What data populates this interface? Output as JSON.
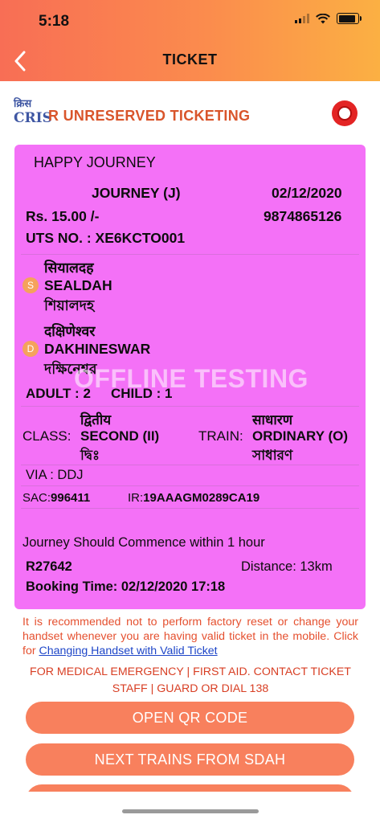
{
  "status_bar": {
    "time": "5:18"
  },
  "header": {
    "title": "TICKET"
  },
  "brand": {
    "logo_top": "क्रिस",
    "logo_bottom": "CRIS",
    "title": "R UNRESERVED TICKETING"
  },
  "ticket": {
    "greeting": "HAPPY JOURNEY",
    "journey_type": "JOURNEY (J)",
    "date": "02/12/2020",
    "fare": "Rs.  15.00 /-",
    "phone": "9874865126",
    "uts_no": "UTS NO. : XE6KCTO001",
    "source": {
      "hindi": "सियालदह",
      "english": "SEALDAH",
      "bengali": "শিয়ালদহ",
      "badge": "S"
    },
    "destination": {
      "hindi": "दक्षिणेश्वर",
      "english": "DAKHINESWAR",
      "bengali": "দক্ষিনেশ্বর",
      "badge": "D"
    },
    "passengers": {
      "adult": "ADULT : 2",
      "child": "CHILD : 1"
    },
    "class_label": "CLASS:",
    "class_hindi": "द्वितीय",
    "class_value": "SECOND (II)",
    "class_bengali": "দ্বিঃ",
    "train_label": "TRAIN:",
    "train_hindi": "साधारण",
    "train_value": "ORDINARY (O)",
    "train_bengali": "সাধারণ",
    "via": "VIA : DDJ",
    "sac_label": "SAC:",
    "sac_value": "996411",
    "ir_label": "IR:",
    "ir_value": "19AAAGM0289CA19",
    "commence": "Journey Should Commence within 1 hour",
    "ref": "R27642",
    "distance": "Distance: 13km",
    "booking_time": "Booking Time:  02/12/2020 17:18",
    "watermark": "OFFLINE TESTING"
  },
  "notice": {
    "text": "It is recommended not to perform factory reset or change your handset whenever you are having valid ticket in the mobile. Click for ",
    "link": "Changing Handset with Valid Ticket"
  },
  "emergency": {
    "line1": "FOR MEDICAL EMERGENCY | FIRST AID. CONTACT TICKET",
    "line2": "STAFF | GUARD OR DIAL 138"
  },
  "buttons": {
    "open_qr": "OPEN QR CODE",
    "next_trains": "NEXT TRAINS FROM SDAH"
  },
  "colors": {
    "header_start": "#f86e55",
    "header_end": "#fbb043",
    "ticket_bg": "#f471f7",
    "button_bg": "#f8805d",
    "brand_text": "#d9552b"
  }
}
